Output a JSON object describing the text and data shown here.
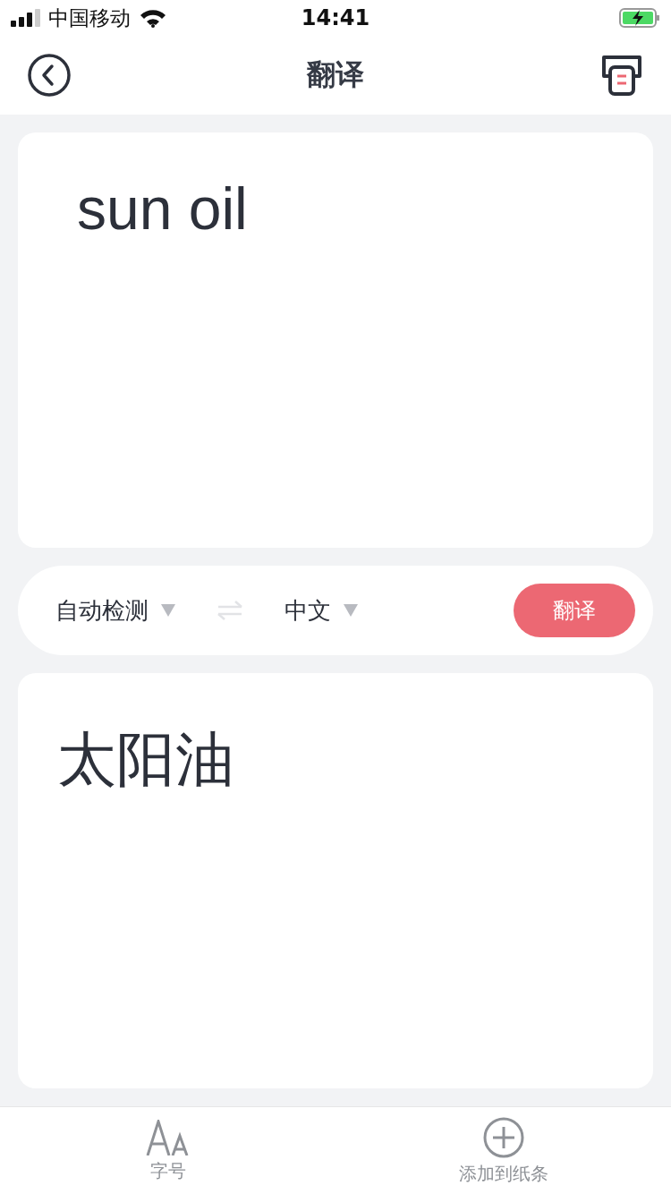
{
  "status_bar": {
    "carrier": "中国移动",
    "time": "14:41"
  },
  "nav": {
    "title": "翻译"
  },
  "source": {
    "value": "sun oil"
  },
  "languages": {
    "from": "自动检测",
    "to": "中文",
    "action": "翻译"
  },
  "result": {
    "text": "太阳油"
  },
  "toolbar": [
    {
      "kind": "font",
      "label": "字号"
    },
    {
      "kind": "add",
      "label": "添加到纸条"
    }
  ]
}
